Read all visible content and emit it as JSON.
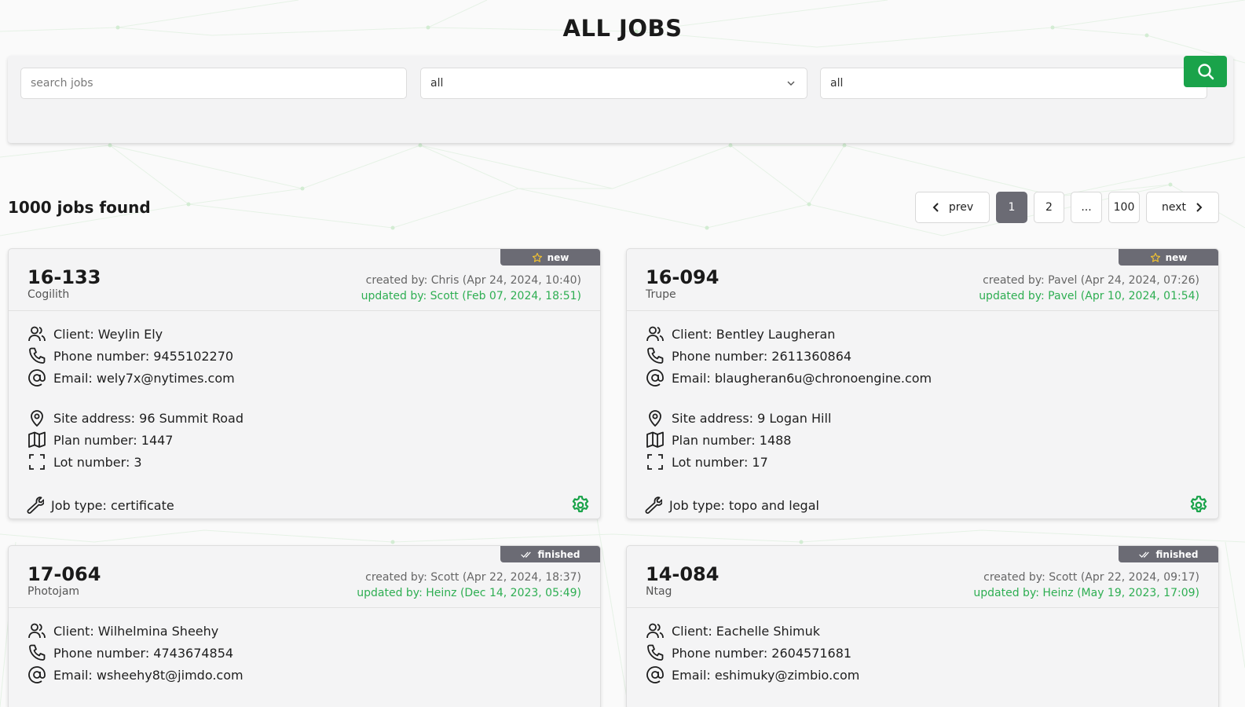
{
  "page": {
    "title": "ALL JOBS"
  },
  "search": {
    "placeholder": "search jobs",
    "filter1": "all",
    "filter2": "all",
    "button_icon": "search-icon"
  },
  "results": {
    "count_text": "1000 jobs found"
  },
  "pagination": {
    "prev": "prev",
    "pages": [
      "1",
      "2",
      "...",
      "100"
    ],
    "active": "1",
    "next": "next"
  },
  "colors": {
    "accent": "#1aa34a",
    "updated": "#2eae52",
    "badge": "#6b6b74"
  },
  "labels": {
    "client": "Client:",
    "phone": "Phone number:",
    "email": "Email:",
    "site": "Site address:",
    "plan": "Plan number:",
    "lot": "Lot number:",
    "jobtype": "Job type:"
  },
  "jobs": [
    {
      "number": "16-133",
      "company": "Cogilith",
      "status": "new",
      "status_icon": "star-icon",
      "created": "created by: Chris (Apr 24, 2024, 10:40)",
      "updated": "updated by: Scott (Feb 07, 2024, 18:51)",
      "client": "Client: Weylin Ely",
      "phone": "Phone number: 9455102270",
      "email": "Email: wely7x@nytimes.com",
      "site": "Site address: 96 Summit Road",
      "plan": "Plan number: 1447",
      "lot": "Lot number: 3",
      "jobtype": "Job type: certificate"
    },
    {
      "number": "16-094",
      "company": "Trupe",
      "status": "new",
      "status_icon": "star-icon",
      "created": "created by: Pavel (Apr 24, 2024, 07:26)",
      "updated": "updated by: Pavel (Apr 10, 2024, 01:54)",
      "client": "Client: Bentley Laugheran",
      "phone": "Phone number: 2611360864",
      "email": "Email: blaugheran6u@chronoengine.com",
      "site": "Site address: 9 Logan Hill",
      "plan": "Plan number: 1488",
      "lot": "Lot number: 17",
      "jobtype": "Job type: topo and legal"
    },
    {
      "number": "17-064",
      "company": "Photojam",
      "status": "finished",
      "status_icon": "double-check-icon",
      "created": "created by: Scott (Apr 22, 2024, 18:37)",
      "updated": "updated by: Heinz (Dec 14, 2023, 05:49)",
      "client": "Client: Wilhelmina Sheehy",
      "phone": "Phone number: 4743674854",
      "email": "Email: wsheehy8t@jimdo.com"
    },
    {
      "number": "14-084",
      "company": "Ntag",
      "status": "finished",
      "status_icon": "double-check-icon",
      "created": "created by: Scott (Apr 22, 2024, 09:17)",
      "updated": "updated by: Heinz (May 19, 2023, 17:09)",
      "client": "Client: Eachelle Shimuk",
      "phone": "Phone number: 2604571681",
      "email": "Email: eshimuky@zimbio.com"
    }
  ]
}
